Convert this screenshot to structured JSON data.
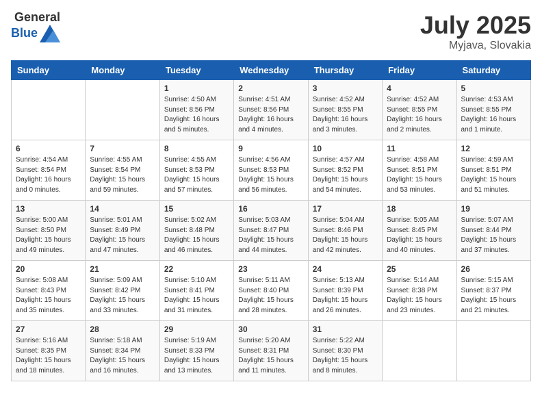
{
  "header": {
    "logo_general": "General",
    "logo_blue": "Blue",
    "month": "July 2025",
    "location": "Myjava, Slovakia"
  },
  "weekdays": [
    "Sunday",
    "Monday",
    "Tuesday",
    "Wednesday",
    "Thursday",
    "Friday",
    "Saturday"
  ],
  "weeks": [
    [
      {
        "day": "",
        "detail": ""
      },
      {
        "day": "",
        "detail": ""
      },
      {
        "day": "1",
        "detail": "Sunrise: 4:50 AM\nSunset: 8:56 PM\nDaylight: 16 hours\nand 5 minutes."
      },
      {
        "day": "2",
        "detail": "Sunrise: 4:51 AM\nSunset: 8:56 PM\nDaylight: 16 hours\nand 4 minutes."
      },
      {
        "day": "3",
        "detail": "Sunrise: 4:52 AM\nSunset: 8:55 PM\nDaylight: 16 hours\nand 3 minutes."
      },
      {
        "day": "4",
        "detail": "Sunrise: 4:52 AM\nSunset: 8:55 PM\nDaylight: 16 hours\nand 2 minutes."
      },
      {
        "day": "5",
        "detail": "Sunrise: 4:53 AM\nSunset: 8:55 PM\nDaylight: 16 hours\nand 1 minute."
      }
    ],
    [
      {
        "day": "6",
        "detail": "Sunrise: 4:54 AM\nSunset: 8:54 PM\nDaylight: 16 hours\nand 0 minutes."
      },
      {
        "day": "7",
        "detail": "Sunrise: 4:55 AM\nSunset: 8:54 PM\nDaylight: 15 hours\nand 59 minutes."
      },
      {
        "day": "8",
        "detail": "Sunrise: 4:55 AM\nSunset: 8:53 PM\nDaylight: 15 hours\nand 57 minutes."
      },
      {
        "day": "9",
        "detail": "Sunrise: 4:56 AM\nSunset: 8:53 PM\nDaylight: 15 hours\nand 56 minutes."
      },
      {
        "day": "10",
        "detail": "Sunrise: 4:57 AM\nSunset: 8:52 PM\nDaylight: 15 hours\nand 54 minutes."
      },
      {
        "day": "11",
        "detail": "Sunrise: 4:58 AM\nSunset: 8:51 PM\nDaylight: 15 hours\nand 53 minutes."
      },
      {
        "day": "12",
        "detail": "Sunrise: 4:59 AM\nSunset: 8:51 PM\nDaylight: 15 hours\nand 51 minutes."
      }
    ],
    [
      {
        "day": "13",
        "detail": "Sunrise: 5:00 AM\nSunset: 8:50 PM\nDaylight: 15 hours\nand 49 minutes."
      },
      {
        "day": "14",
        "detail": "Sunrise: 5:01 AM\nSunset: 8:49 PM\nDaylight: 15 hours\nand 47 minutes."
      },
      {
        "day": "15",
        "detail": "Sunrise: 5:02 AM\nSunset: 8:48 PM\nDaylight: 15 hours\nand 46 minutes."
      },
      {
        "day": "16",
        "detail": "Sunrise: 5:03 AM\nSunset: 8:47 PM\nDaylight: 15 hours\nand 44 minutes."
      },
      {
        "day": "17",
        "detail": "Sunrise: 5:04 AM\nSunset: 8:46 PM\nDaylight: 15 hours\nand 42 minutes."
      },
      {
        "day": "18",
        "detail": "Sunrise: 5:05 AM\nSunset: 8:45 PM\nDaylight: 15 hours\nand 40 minutes."
      },
      {
        "day": "19",
        "detail": "Sunrise: 5:07 AM\nSunset: 8:44 PM\nDaylight: 15 hours\nand 37 minutes."
      }
    ],
    [
      {
        "day": "20",
        "detail": "Sunrise: 5:08 AM\nSunset: 8:43 PM\nDaylight: 15 hours\nand 35 minutes."
      },
      {
        "day": "21",
        "detail": "Sunrise: 5:09 AM\nSunset: 8:42 PM\nDaylight: 15 hours\nand 33 minutes."
      },
      {
        "day": "22",
        "detail": "Sunrise: 5:10 AM\nSunset: 8:41 PM\nDaylight: 15 hours\nand 31 minutes."
      },
      {
        "day": "23",
        "detail": "Sunrise: 5:11 AM\nSunset: 8:40 PM\nDaylight: 15 hours\nand 28 minutes."
      },
      {
        "day": "24",
        "detail": "Sunrise: 5:13 AM\nSunset: 8:39 PM\nDaylight: 15 hours\nand 26 minutes."
      },
      {
        "day": "25",
        "detail": "Sunrise: 5:14 AM\nSunset: 8:38 PM\nDaylight: 15 hours\nand 23 minutes."
      },
      {
        "day": "26",
        "detail": "Sunrise: 5:15 AM\nSunset: 8:37 PM\nDaylight: 15 hours\nand 21 minutes."
      }
    ],
    [
      {
        "day": "27",
        "detail": "Sunrise: 5:16 AM\nSunset: 8:35 PM\nDaylight: 15 hours\nand 18 minutes."
      },
      {
        "day": "28",
        "detail": "Sunrise: 5:18 AM\nSunset: 8:34 PM\nDaylight: 15 hours\nand 16 minutes."
      },
      {
        "day": "29",
        "detail": "Sunrise: 5:19 AM\nSunset: 8:33 PM\nDaylight: 15 hours\nand 13 minutes."
      },
      {
        "day": "30",
        "detail": "Sunrise: 5:20 AM\nSunset: 8:31 PM\nDaylight: 15 hours\nand 11 minutes."
      },
      {
        "day": "31",
        "detail": "Sunrise: 5:22 AM\nSunset: 8:30 PM\nDaylight: 15 hours\nand 8 minutes."
      },
      {
        "day": "",
        "detail": ""
      },
      {
        "day": "",
        "detail": ""
      }
    ]
  ]
}
